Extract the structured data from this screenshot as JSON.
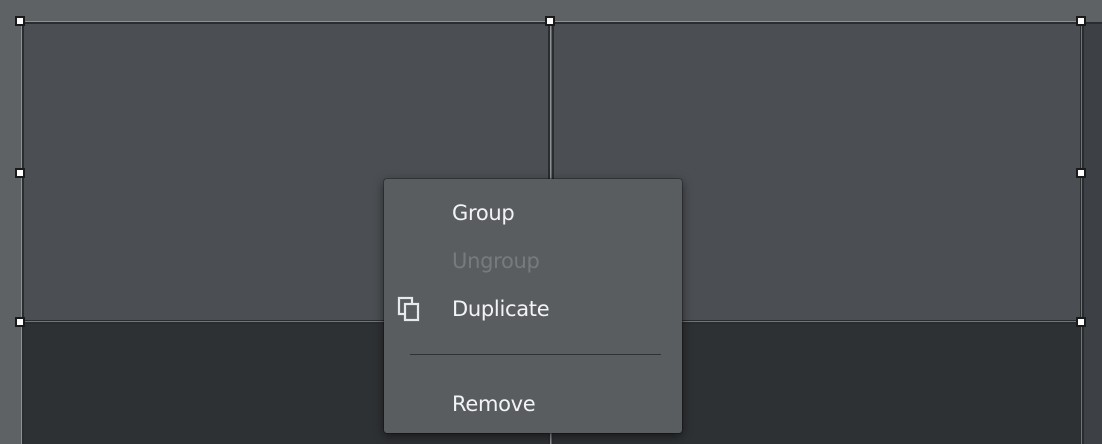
{
  "context_menu": {
    "items": [
      {
        "label": "Group",
        "enabled": true,
        "icon": null
      },
      {
        "label": "Ungroup",
        "enabled": false,
        "icon": null
      },
      {
        "label": "Duplicate",
        "enabled": true,
        "icon": "duplicate-icon"
      },
      {
        "label": "Remove",
        "enabled": true,
        "icon": null
      }
    ]
  },
  "colors": {
    "menu_background": "#5a5d60",
    "menu_text": "#f2f3f4",
    "menu_text_disabled": "#777b7e",
    "cell_light": "#4b4f53",
    "cell_dark": "#2e3134",
    "handle_fill": "#ffffff"
  }
}
